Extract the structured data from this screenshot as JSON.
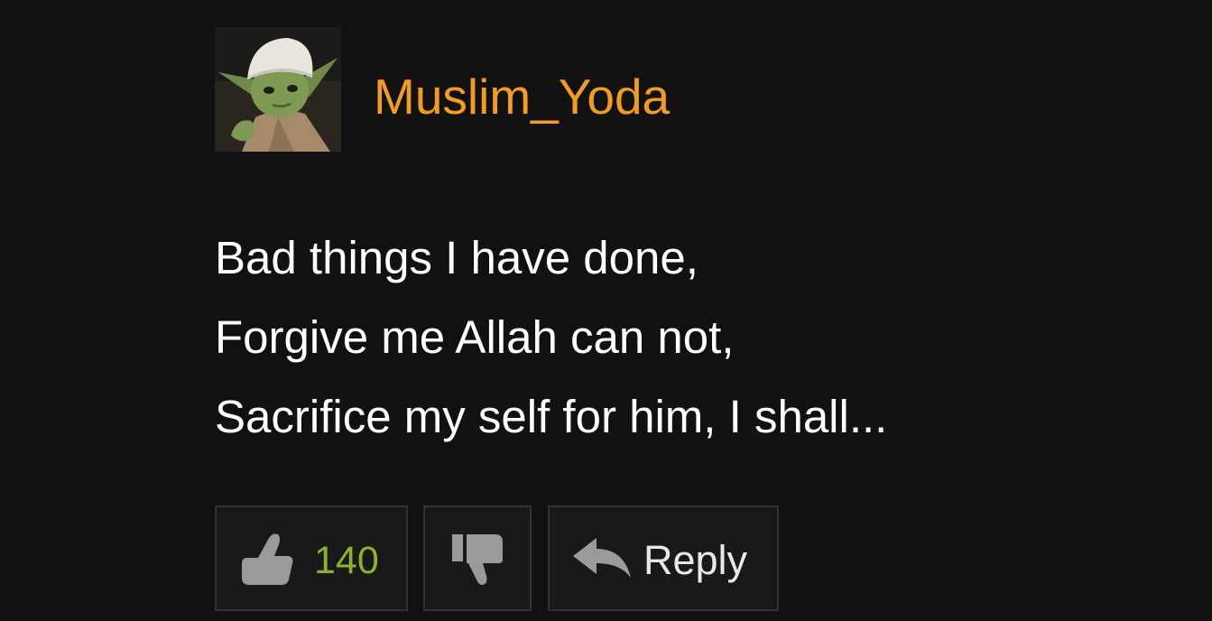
{
  "comment": {
    "username": "Muslim_Yoda",
    "avatar": "yoda-avatar",
    "body_lines": [
      "Bad things I have done,",
      "Forgive me Allah can not,",
      "Sacrifice my self for him, I shall..."
    ],
    "actions": {
      "like_icon": "thumbs-up-icon",
      "like_count": "140",
      "dislike_icon": "thumbs-down-icon",
      "reply_icon": "reply-arrow-icon",
      "reply_label": "Reply"
    }
  },
  "colors": {
    "background": "#121111",
    "username": "#f39c1f",
    "body_text": "#ffffff",
    "like_count": "#8bb32c",
    "button_border": "#333232",
    "icon": "#9a9a9a"
  }
}
